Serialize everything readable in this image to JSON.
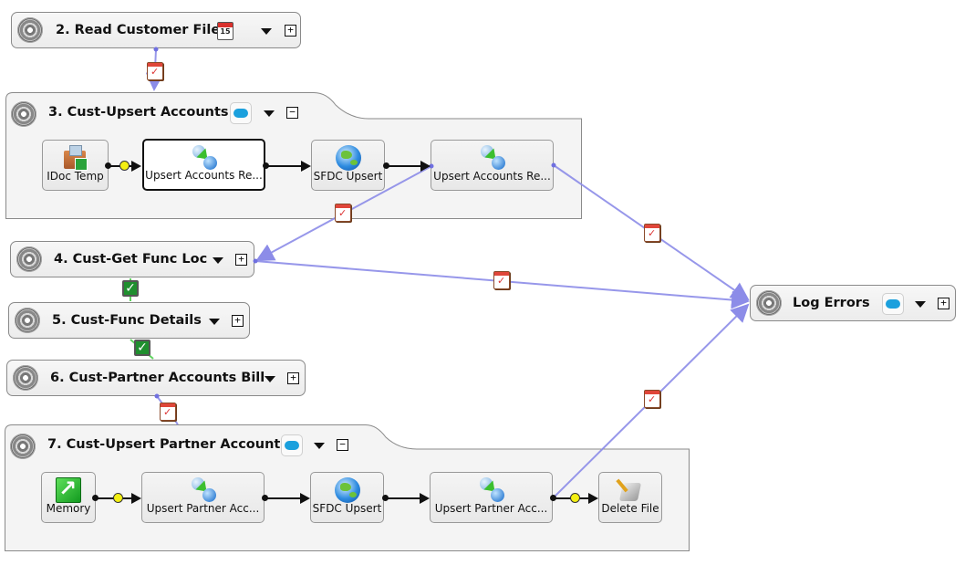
{
  "operations": {
    "read_customer_files": {
      "title": "2. Read Customer Files",
      "schedule_badge": "15",
      "expanded": false
    },
    "cust_upsert_accounts": {
      "title": "3. Cust-Upsert Accounts",
      "expanded": true,
      "steps": [
        {
          "label": "IDoc Temp",
          "icon": "source-box-icon"
        },
        {
          "label": "Upsert Accounts Re...",
          "icon": "transformation-icon",
          "selected": true
        },
        {
          "label": "SFDC Upsert",
          "icon": "globe-icon"
        },
        {
          "label": "Upsert Accounts Re...",
          "icon": "transformation-icon"
        }
      ]
    },
    "cust_get_func_loc": {
      "title": "4. Cust-Get Func Loc",
      "expanded": false
    },
    "cust_func_details": {
      "title": "5. Cust-Func Details",
      "expanded": false
    },
    "cust_partner_accounts_bill": {
      "title": "6. Cust-Partner Accounts Bill",
      "expanded": false
    },
    "cust_upsert_partner_accounts": {
      "title": "7. Cust-Upsert Partner Accounts",
      "expanded": true,
      "steps": [
        {
          "label": "Memory",
          "icon": "memory-icon"
        },
        {
          "label": "Upsert Partner Acc...",
          "icon": "transformation-icon"
        },
        {
          "label": "SFDC Upsert",
          "icon": "globe-icon"
        },
        {
          "label": "Upsert Partner Acc...",
          "icon": "transformation-icon"
        },
        {
          "label": "Delete File",
          "icon": "delete-file-icon"
        }
      ]
    },
    "log_errors": {
      "title": "Log Errors",
      "expanded": false
    }
  },
  "toggle_symbols": {
    "expand": "+",
    "collapse": "−"
  },
  "ok_symbol": "✓",
  "colors": {
    "link": "#8c8ce8",
    "success_link": "#5fd45f",
    "selected_border": "#111111",
    "salesforce": "#1ba0dd"
  }
}
